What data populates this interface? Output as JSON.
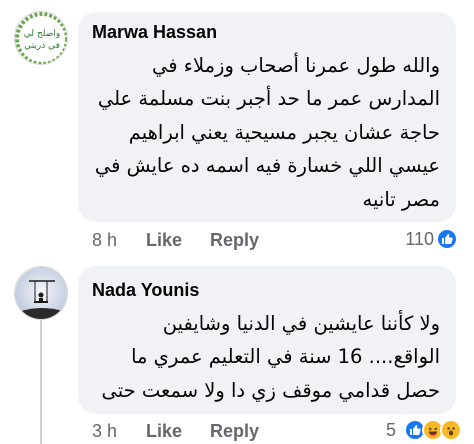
{
  "comments": [
    {
      "author": "Marwa Hassan",
      "lines": [
        "والله طول عمرنا أصحاب وزملاء في",
        "المدارس عمر ما حد أجبر بنت مسلمة علي",
        "حاجة عشان يجبر مسيحية يعني ابراهيم",
        "عيسي اللي خسارة فيه اسمه ده عايش في",
        "مصر تانيه"
      ],
      "time": "8 h",
      "like_label": "Like",
      "reply_label": "Reply",
      "reaction_count": "110",
      "avatar_text_top": "واصلح لي",
      "avatar_text_bottom": "في ذريتي"
    },
    {
      "author": "Nada Younis",
      "lines": [
        "ولا كأننا عايشين في الدنيا وشايفين",
        "الواقع.... 16 سنة في التعليم عمري ما",
        "حصل قدامي موقف زي دا ولا سمعت حتى"
      ],
      "time": "3 h",
      "like_label": "Like",
      "reply_label": "Reply",
      "reaction_count": "5"
    }
  ],
  "colors": {
    "bubble": "#f0f2f5",
    "secondary_text": "#65676b",
    "like_blue": "#1877f2",
    "emoji_yellow": "#f7b928"
  },
  "icons": {
    "avatar_1": "calligraphy-badge-avatar",
    "avatar_2": "swing-silhouette-avatar",
    "reaction_like": "thumbs-up-icon",
    "reaction_haha": "laughing-face-icon",
    "reaction_wow": "wow-face-icon"
  }
}
